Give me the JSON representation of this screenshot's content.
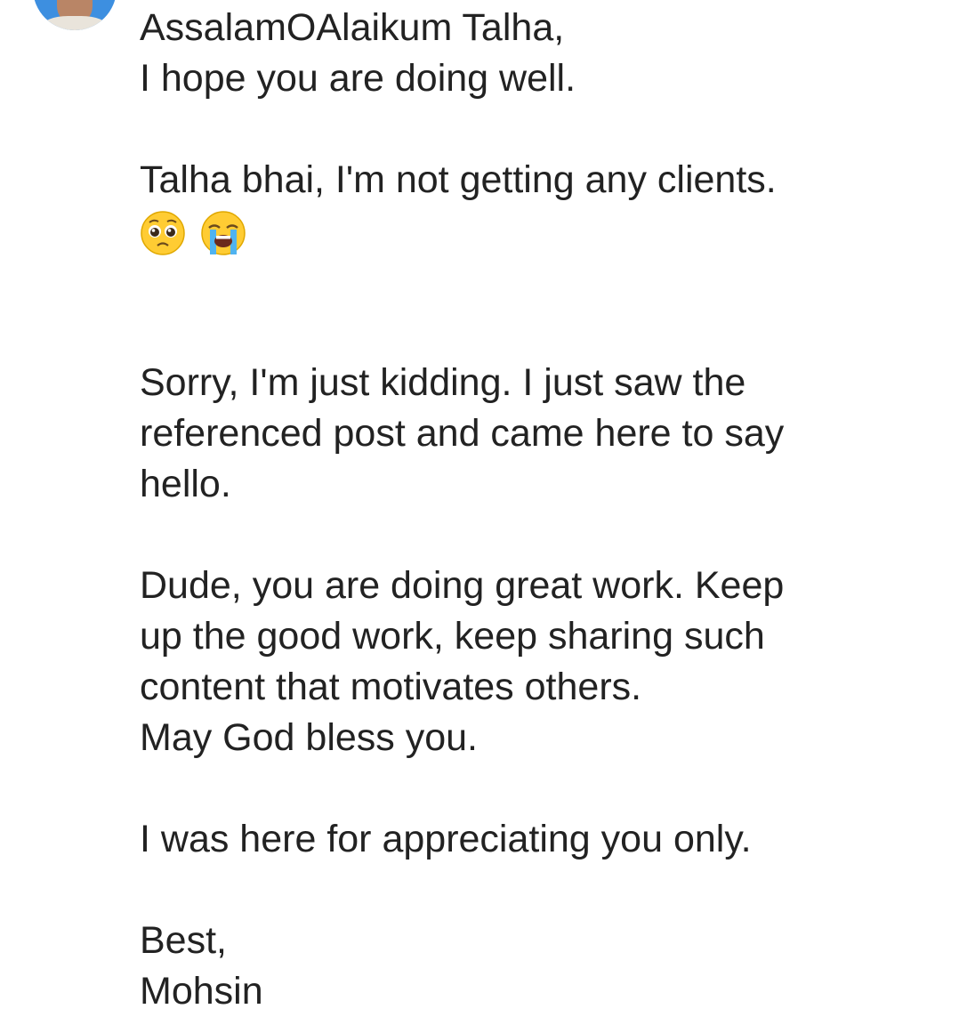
{
  "sender": {
    "avatar_icon": "user-avatar-photo"
  },
  "message": {
    "greeting": "AssalamOAlaikum Talha,",
    "line_hope": "I hope you are doing well.",
    "line_clients": "Talha bhai, I'm not getting any clients.",
    "emojis": [
      "pleading-face-emoji",
      "loudly-crying-face-emoji"
    ],
    "sorry_lines": [
      "Sorry, I'm just kidding. I just saw the",
      "referenced post and came here to say",
      "hello."
    ],
    "praise_lines": [
      "Dude, you are doing great work. Keep",
      "up the good work, keep sharing such",
      "content that motivates others.",
      "May God bless you."
    ],
    "appreciation": "I was here for appreciating you only.",
    "signoff": "Best,",
    "signature": "Mohsin"
  },
  "colors": {
    "text": "#222222",
    "avatar_bg": "#3d8fe0",
    "background": "#ffffff"
  }
}
